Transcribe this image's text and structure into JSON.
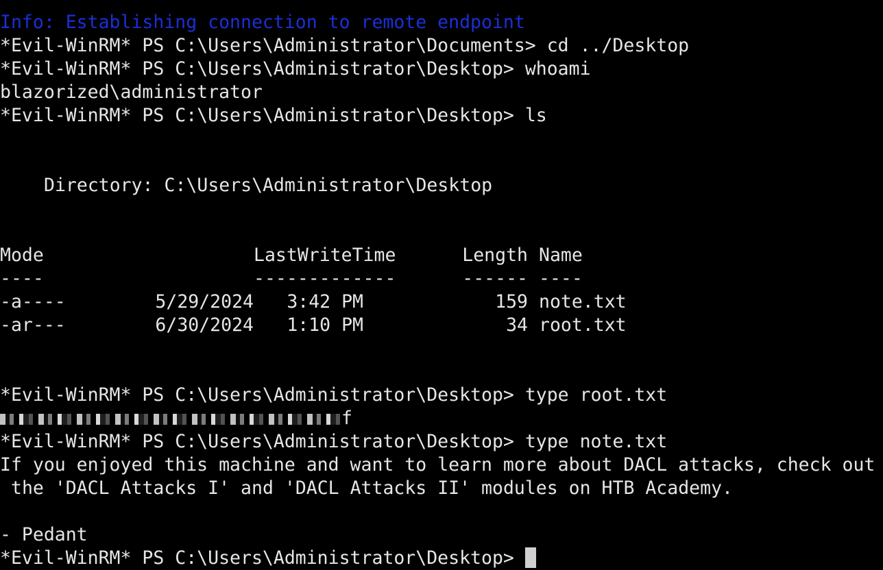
{
  "terminal": {
    "info_line": "Info: Establishing connection to remote endpoint",
    "prompt": "*Evil-WinRM* PS C:\\Users\\Administrator\\Documents> ",
    "prompt_desktop": "*Evil-WinRM* PS C:\\Users\\Administrator\\Desktop> ",
    "cmd_cd": "cd ../Desktop",
    "cmd_whoami": "whoami",
    "whoami_output": "blazorized\\administrator",
    "cmd_ls": "ls",
    "directory_line": "Directory: C:\\Users\\Administrator\\Desktop",
    "headers": {
      "mode": "Mode",
      "lastwritetime": "LastWriteTime",
      "length": "Length",
      "name": "Name"
    },
    "underlines": {
      "mode": "----",
      "lastwritetime": "-------------",
      "length": "------",
      "name": "----"
    },
    "rows": [
      {
        "mode": "-a----",
        "date": "5/29/2024",
        "time": "3:42 PM",
        "length": "159",
        "name": "note.txt"
      },
      {
        "mode": "-ar---",
        "date": "6/30/2024",
        "time": "1:10 PM",
        "length": "34",
        "name": "root.txt"
      }
    ],
    "cmd_type_root": "type root.txt",
    "root_flag_tail": "f",
    "cmd_type_note": "type note.txt",
    "note_line1": "If you enjoyed this machine and want to learn more about DACL attacks, check out",
    "note_line2": "the 'DACL Attacks I' and 'DACL Attacks II' modules on HTB Academy.",
    "note_signature": "- Pedant"
  },
  "colors": {
    "background": "#000000",
    "text": "#e6e6e6",
    "info": "#1a2fd8"
  }
}
